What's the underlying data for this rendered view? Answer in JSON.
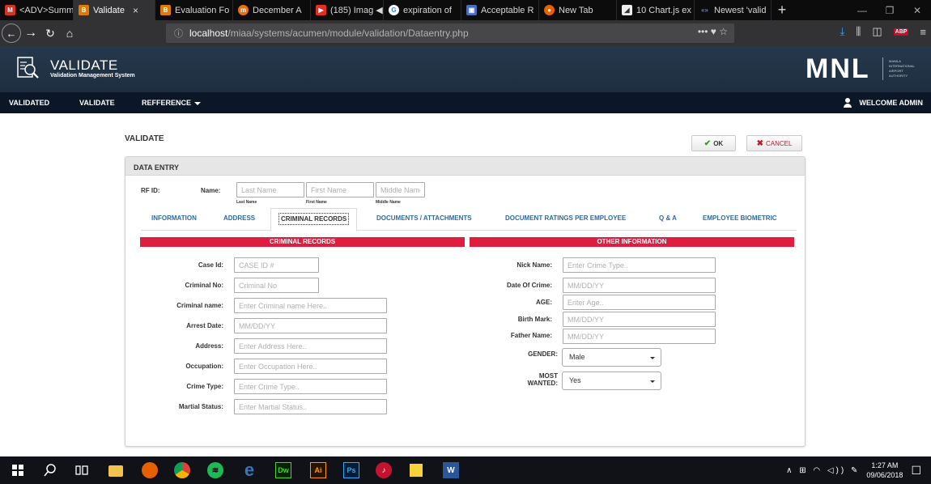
{
  "browser": {
    "tabs": [
      {
        "label": "<ADV>Summ",
        "color": "#d93025",
        "glyph": "M"
      },
      {
        "label": "Validate",
        "color": "#e07b00",
        "glyph": "B",
        "active": true
      },
      {
        "label": "Evaluation Fo",
        "color": "#e07b00",
        "glyph": "B"
      },
      {
        "label": "December A",
        "color": "#e8710a",
        "glyph": "m"
      },
      {
        "label": "(185) Imag",
        "color": "#e52d27",
        "glyph": "▶"
      },
      {
        "label": "expiration of",
        "color": "#ffffff",
        "glyph": "G"
      },
      {
        "label": "Acceptable R",
        "color": "#4a6cbd",
        "glyph": "▣"
      },
      {
        "label": "New Tab",
        "color": "#e66000",
        "glyph": "●"
      },
      {
        "label": "10 Chart.js ex",
        "color": "#eeeeee",
        "glyph": "◢"
      },
      {
        "label": "Newest 'valid",
        "color": "#6a7bd0",
        "glyph": "«»"
      }
    ],
    "close_tab": "×",
    "new_tab": "+",
    "url_host": "localhost",
    "url_path": "/miaa/systems/acumen/module/validation/Dataentry.php",
    "url_actions": "••• ♥ ☆"
  },
  "app": {
    "title": "VALIDATE",
    "subtitle": "Validation Management System",
    "brand": "MNL",
    "brand_sub": "MANILA INTERNATIONAL AIRPORT AUTHORITY",
    "menu": [
      "VALIDATED",
      "VALIDATE",
      "REFFERENCE"
    ],
    "welcome": "WELCOME ADMIN"
  },
  "page": {
    "title": "VALIDATE",
    "ok_label": "OK",
    "cancel_label": "CANCEL",
    "card_title": "DATA ENTRY",
    "rfid_label": "RF ID:",
    "name_label": "Name:",
    "name_fields": [
      {
        "placeholder": "Last Name",
        "sublabel": "Last Name"
      },
      {
        "placeholder": "First Name",
        "sublabel": "First Name"
      },
      {
        "placeholder": "Middle Name",
        "sublabel": "Middle Name"
      }
    ],
    "tabs": [
      "INFORMATION",
      "ADDRESS",
      "CRIMINAL RECORDS",
      "DOCUMENTS / ATTACHMENTS",
      "DOCUMENT RATINGS PER EMPLOYEE",
      "Q & A",
      "EMPLOYEE BIOMETRIC"
    ],
    "active_tab": "CRIMINAL RECORDS",
    "section_left": "CRIMINAL RECORDS",
    "section_right": "OTHER INFORMATION",
    "left_fields": [
      {
        "label": "Case Id:",
        "placeholder": "CASE ID #"
      },
      {
        "label": "Criminal No:",
        "placeholder": "Criminal No"
      },
      {
        "label": "Criminal name:",
        "placeholder": "Enter Criminal name Here.."
      },
      {
        "label": "Arrest Date:",
        "placeholder": "MM/DD/YY"
      },
      {
        "label": "Address:",
        "placeholder": "Enter Address Here.."
      },
      {
        "label": "Occupation:",
        "placeholder": "Enter Occupation Here.."
      },
      {
        "label": "Crime Type:",
        "placeholder": "Enter Crime Type.."
      },
      {
        "label": "Martial Status:",
        "placeholder": "Enter Martial Status.."
      }
    ],
    "right_fields": [
      {
        "label": "Nick Name:",
        "placeholder": "Enter Crime Type.."
      },
      {
        "label": "Date Of Crime:",
        "placeholder": "MM/DD/YY"
      },
      {
        "label": "AGE:",
        "placeholder": "Enter Age.."
      },
      {
        "label": "Birth Mark:",
        "placeholder": "MM/DD/YY"
      },
      {
        "label": "Father Name:",
        "placeholder": "MM/DD/YY"
      }
    ],
    "gender_label": "GENDER:",
    "gender_value": "Male",
    "most_wanted_label_1": "MOST",
    "most_wanted_label_2": "WANTED:",
    "most_wanted_value": "Yes"
  },
  "taskbar": {
    "time": "1:27 AM",
    "date": "09/06/2018",
    "tray_icons": "∧ ⊞ ◠ ◁)) ✎"
  }
}
